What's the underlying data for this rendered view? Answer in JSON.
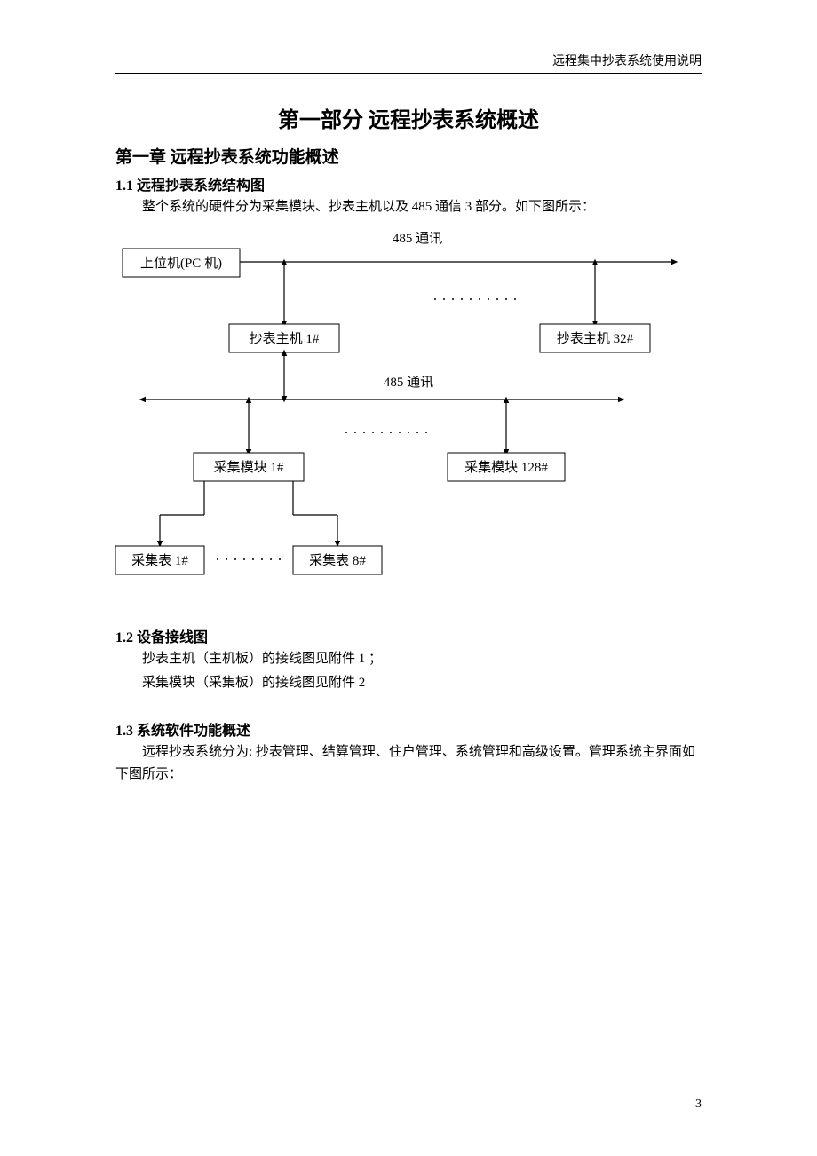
{
  "header": "远程集中抄表系统使用说明",
  "page_number": "3",
  "part_title": "第一部分  远程抄表系统概述",
  "chapter_title": "第一章  远程抄表系统功能概述",
  "s11_title": "1.1  远程抄表系统结构图",
  "s11_para": "整个系统的硬件分为采集模块、抄表主机以及 485 通信 3 部分。如下图所示：",
  "diagram": {
    "comm_top": "485 通讯",
    "pc": "上位机(PC 机)",
    "host1": "抄表主机 1#",
    "host32": "抄表主机 32#",
    "comm_mid": "485 通讯",
    "mod1": "采集模块 1#",
    "mod128": "采集模块 128#",
    "meter1": "采集表 1#",
    "meter8": "采集表 8#"
  },
  "s12_title": "1.2  设备接线图",
  "s12_line1": "抄表主机（主机板）的接线图见附件 1 ；",
  "s12_line2": "采集模块（采集板）的接线图见附件 2",
  "s13_title": "1.3  系统软件功能概述",
  "s13_para": "远程抄表系统分为: 抄表管理、结算管理、住户管理、系统管理和高级设置。管理系统主界面如下图所示："
}
